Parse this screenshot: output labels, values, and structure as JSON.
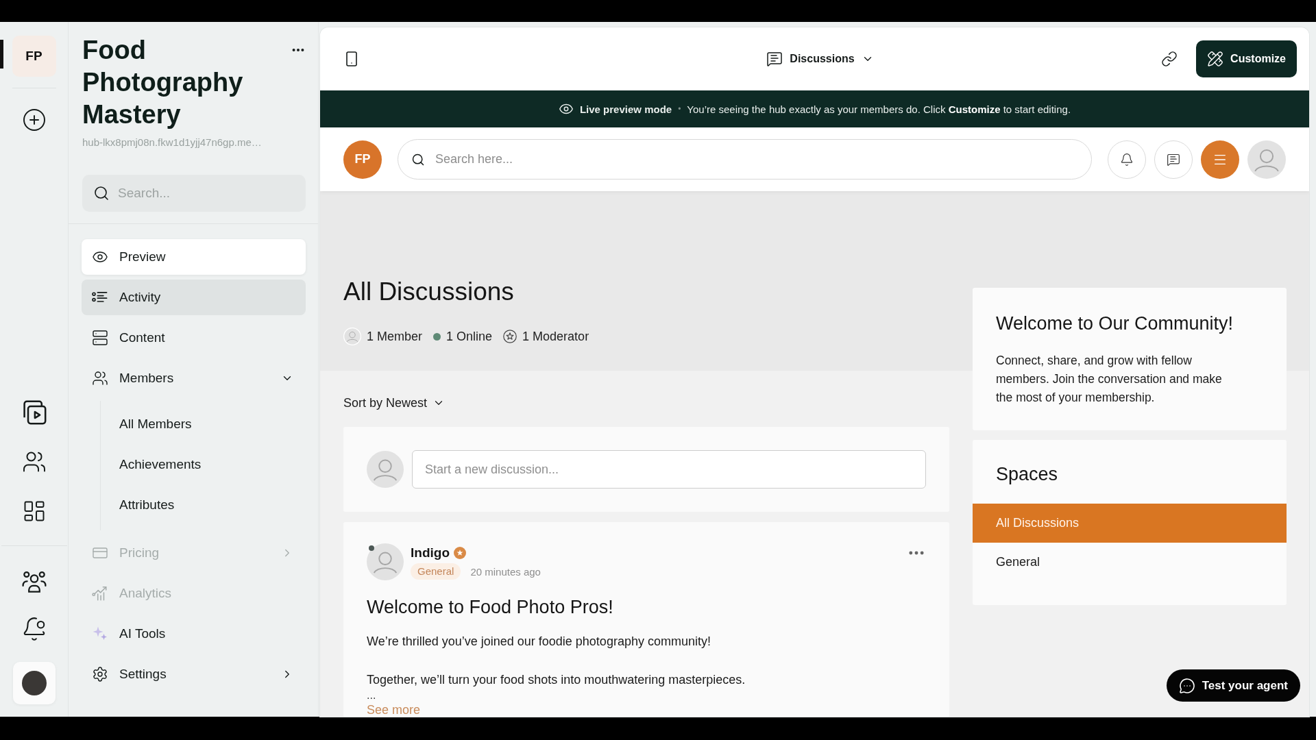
{
  "workspace": {
    "initials": "FP",
    "selected": true
  },
  "sidebar": {
    "title": "Food Photography Mastery",
    "url": "hub-lkx8pmj08n.fkw1d1yjj47n6gp.me…",
    "search": {
      "placeholder": "Search..."
    },
    "items": [
      {
        "label": "Preview",
        "selected": true,
        "hovered": false,
        "disabled": false
      },
      {
        "label": "Activity",
        "selected": false,
        "hovered": true,
        "disabled": false
      },
      {
        "label": "Content",
        "selected": false,
        "hovered": false,
        "disabled": false
      },
      {
        "label": "Members",
        "selected": false,
        "hovered": false,
        "disabled": false,
        "expanded": true,
        "children": [
          {
            "label": "All Members",
            "selected": false
          },
          {
            "label": "Achievements",
            "selected": false
          },
          {
            "label": "Attributes",
            "selected": false
          }
        ]
      },
      {
        "label": "Pricing",
        "selected": false,
        "hovered": false,
        "disabled": true,
        "expanded": false
      },
      {
        "label": "Analytics",
        "selected": false,
        "hovered": false,
        "disabled": true
      },
      {
        "label": "AI Tools",
        "selected": false,
        "hovered": false,
        "disabled": false
      },
      {
        "label": "Settings",
        "selected": false,
        "hovered": false,
        "disabled": false,
        "expanded": false
      }
    ]
  },
  "toolbar": {
    "view": "Discussions",
    "customize": "Customize"
  },
  "banner": {
    "title": "Live preview mode",
    "separator": "•",
    "message": "You’re seeing the hub exactly as your members do. Click **Customize** to start editing."
  },
  "hub_header": {
    "logo": "FP",
    "search": {
      "placeholder": "Search here..."
    }
  },
  "page": {
    "title": "All Discussions",
    "stats": [
      {
        "kind": "members",
        "label": "1 Member"
      },
      {
        "kind": "online",
        "label": "1 Online"
      },
      {
        "kind": "moderators",
        "label": "1 Moderator"
      }
    ],
    "sort": "Sort by Newest",
    "composer": {
      "placeholder": "Start a new discussion..."
    },
    "posts": [
      {
        "author": "Indigo",
        "online": true,
        "badge": true,
        "space": "General",
        "time": "20 minutes ago",
        "title": "Welcome to Food Photo Pros!",
        "body": [
          "We’re thrilled you’ve joined our foodie photography community!",
          "Together, we’ll turn your food shots into mouthwatering masterpieces."
        ],
        "ellipsis": "...",
        "see_more": "See more"
      }
    ]
  },
  "aside": {
    "welcome": {
      "title": "Welcome to Our Community!",
      "text": "Connect, share, and grow with fellow members. Join the conversation and make the most of your membership."
    },
    "spaces": {
      "title": "Spaces",
      "items": [
        {
          "label": "All Discussions",
          "selected": true
        },
        {
          "label": "General",
          "selected": false
        }
      ]
    }
  },
  "agent_button": "Test your agent"
}
